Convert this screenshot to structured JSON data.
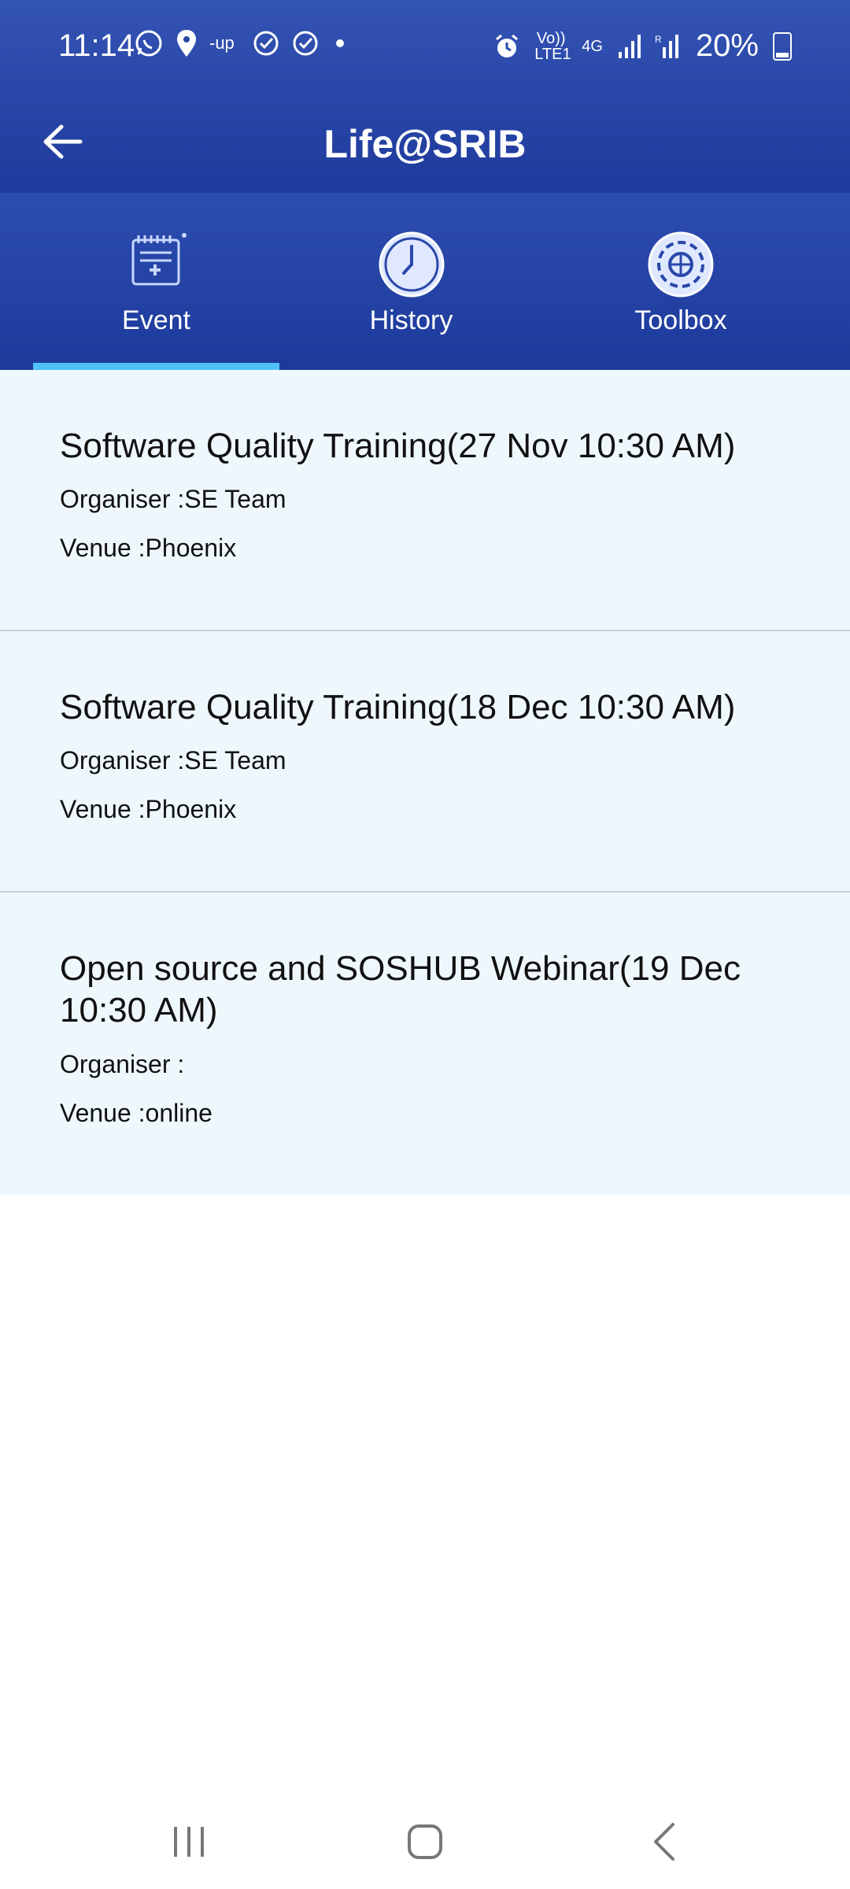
{
  "status_bar": {
    "time": "11:14",
    "battery": "20%",
    "network_vo": "Vo)) LTE1",
    "network_4g": "4G"
  },
  "app_bar": {
    "title": "Life@SRIB"
  },
  "tabs": [
    {
      "label": "Event",
      "icon": "calendar-plus-icon",
      "selected": true
    },
    {
      "label": "History",
      "icon": "clock-icon",
      "selected": false
    },
    {
      "label": "Toolbox",
      "icon": "gear-icon",
      "selected": false
    }
  ],
  "events": [
    {
      "title": "Software Quality Training(27 Nov 10:30 AM)",
      "organiser": "Organiser :SE Team",
      "venue": "Venue :Phoenix"
    },
    {
      "title": "Software Quality Training(18 Dec 10:30 AM)",
      "organiser": "Organiser :SE Team",
      "venue": "Venue :Phoenix"
    },
    {
      "title": "Open source and SOSHUB Webinar(19 Dec 10:30 AM)",
      "organiser": "Organiser :",
      "venue": "Venue :online"
    }
  ],
  "colors": {
    "header": "#2a48aa",
    "tab_indicator": "#4fc3f7",
    "list_background": "#eef8fc"
  }
}
